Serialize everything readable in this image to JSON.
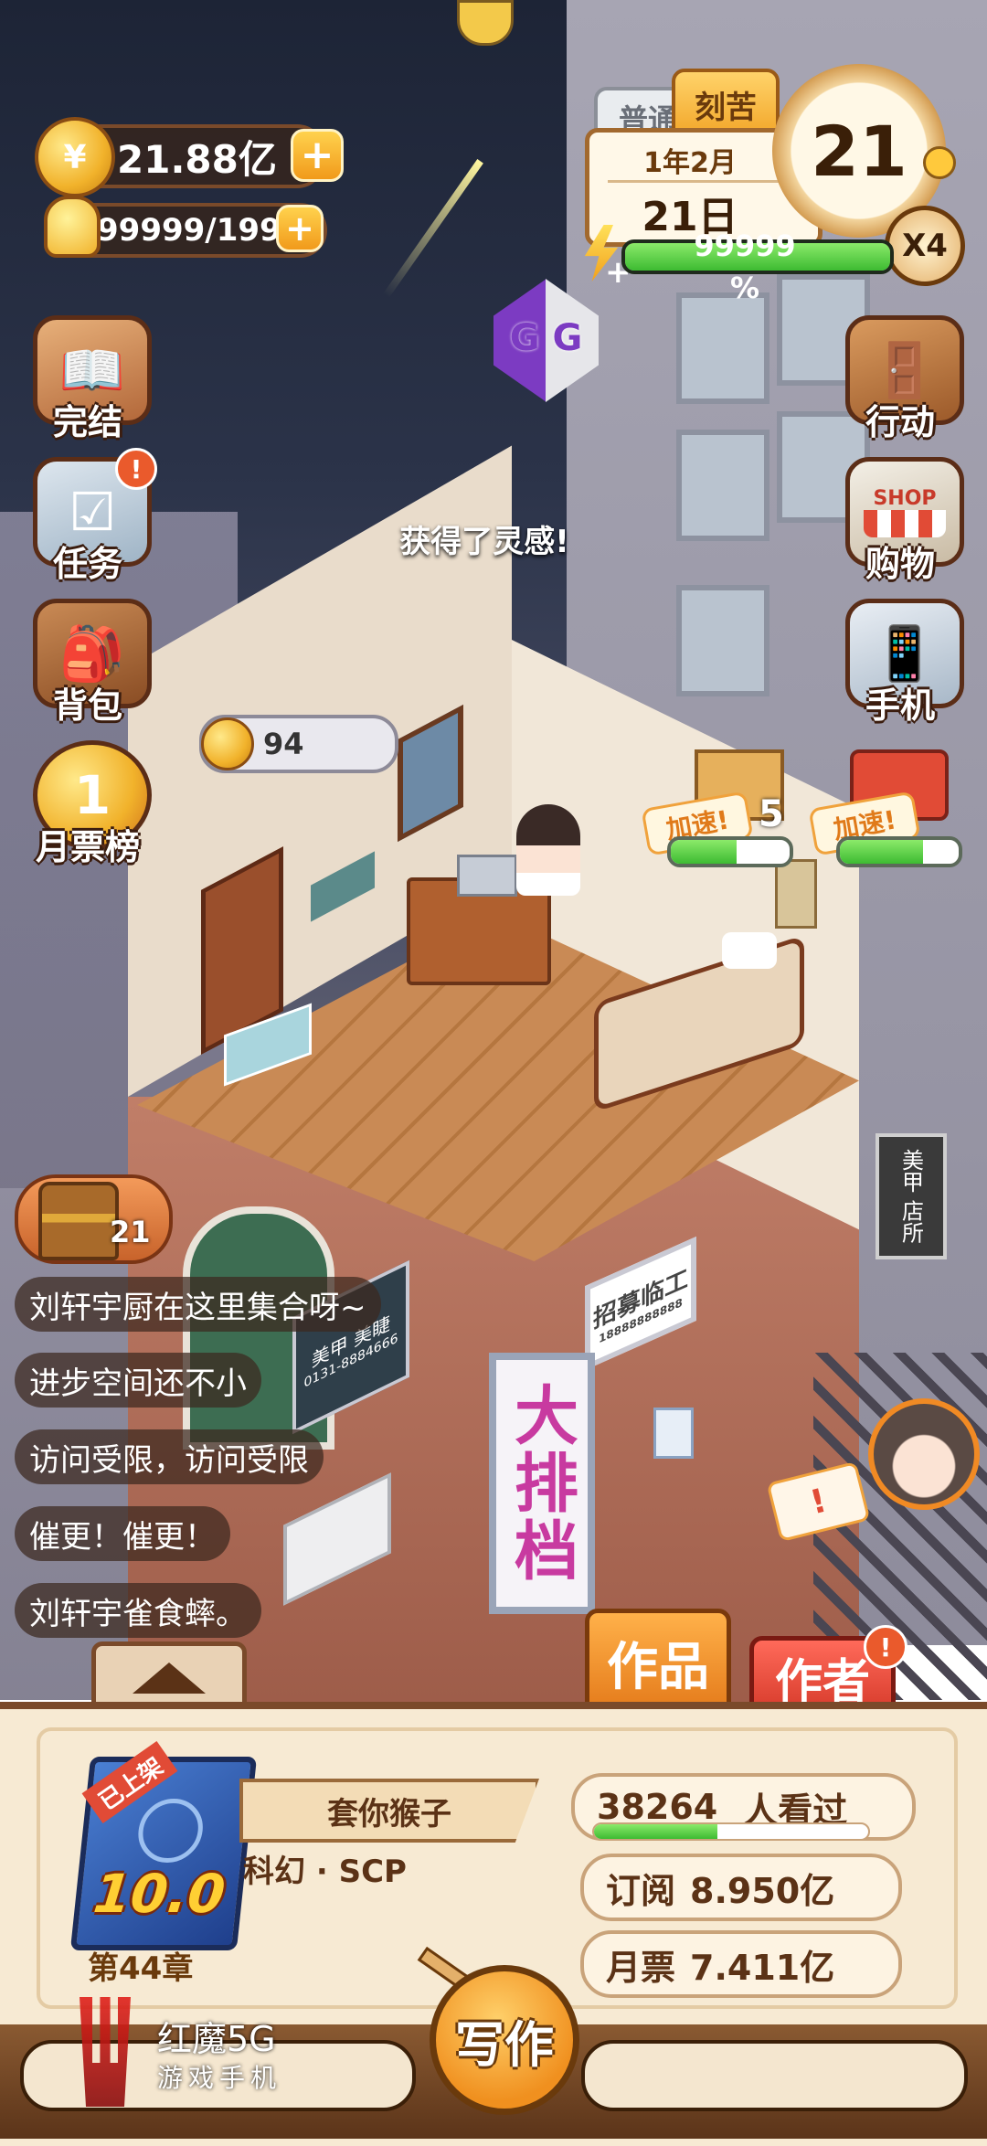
{
  "hud": {
    "gold_amount": "21.88亿",
    "inspiration_amount": "99999/1999",
    "mode_normal": "普通",
    "mode_hard": "刻苦",
    "date_month": "1年2月",
    "date_day": "21日",
    "day_counter": "21",
    "speed_label": "X4",
    "energy_value": "99999",
    "energy_unit": "%",
    "energy_fraction": 1.0
  },
  "left_menu": [
    {
      "label": "完结",
      "icon": "book-icon"
    },
    {
      "label": "任务",
      "icon": "checklist-icon",
      "alert": true
    },
    {
      "label": "背包",
      "icon": "backpack-icon"
    },
    {
      "label": "月票榜",
      "icon": "ticket-coin-icon"
    }
  ],
  "right_menu": [
    {
      "label": "行动",
      "icon": "door-icon"
    },
    {
      "label": "购物",
      "icon": "shop-icon",
      "sublabel": "SHOP"
    },
    {
      "label": "手机",
      "icon": "phone-icon"
    }
  ],
  "scene": {
    "gg_badge": "G G",
    "toast": "获得了灵感!",
    "coin_bubble_value": "94",
    "boost_label_1": "加速!",
    "boost_count_1": "5",
    "boost_label_2": "加速!",
    "boost_progress_1": 0.55,
    "boost_progress_2": 0.7,
    "treasure_count": "21",
    "shop_sign_text": "美甲 美睫",
    "shop_sign_phone": "0131-8884666",
    "hiring_sign": "招募临工",
    "hiring_sign_small": "18888888888",
    "banner_text": "大排档",
    "side_sign": "美甲 店所"
  },
  "chat": [
    "刘轩宇厨在这里集合呀~",
    "进步空间还不小",
    "访问受限，访问受限",
    "催更！催更！",
    "刘轩宇雀食蟀。"
  ],
  "tabs": {
    "works": "作品",
    "author": "作者"
  },
  "book": {
    "shelf_tag": "已上架",
    "rating": "10.0",
    "title": "套你猴子",
    "genre": "科幻 · SCP",
    "chapter": "第44章",
    "views_value": "38264",
    "views_label": "人看过",
    "views_progress": 0.45,
    "subscriptions_label": "订阅",
    "subscriptions_value": "8.950亿",
    "monthly_label": "月票",
    "monthly_value": "7.411亿"
  },
  "bottom": {
    "write_button": "写作",
    "brand_name": "红魔5G",
    "brand_sub": "游戏手机"
  },
  "colors": {
    "accent_orange": "#f08a24",
    "panel_cream": "#f7ead3",
    "panel_border": "#7a4a2a",
    "green_bar": "#3dbb32"
  }
}
